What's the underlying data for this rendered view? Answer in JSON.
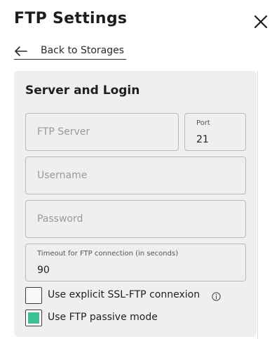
{
  "header": {
    "title": "FTP Settings",
    "back_label": "Back to Storages",
    "back_icon": "arrow-left-icon",
    "close_icon": "close-icon"
  },
  "section": {
    "title": "Server and Login"
  },
  "fields": {
    "server": {
      "placeholder": "FTP Server",
      "value": ""
    },
    "port": {
      "label": "Port",
      "value": "21"
    },
    "username": {
      "placeholder": "Username",
      "value": ""
    },
    "password": {
      "placeholder": "Password",
      "value": ""
    },
    "timeout": {
      "label": "Timeout for FTP connection (in seconds)",
      "value": "90"
    }
  },
  "options": {
    "ssl": {
      "label": "Use explicit SSL-FTP connexion",
      "checked": false,
      "info_icon": "info-icon"
    },
    "passive": {
      "label": "Use FTP passive mode",
      "checked": true
    }
  },
  "colors": {
    "accent": "#3fbf96",
    "card_background": "#efefef",
    "field_border": "#b9b9b9"
  }
}
